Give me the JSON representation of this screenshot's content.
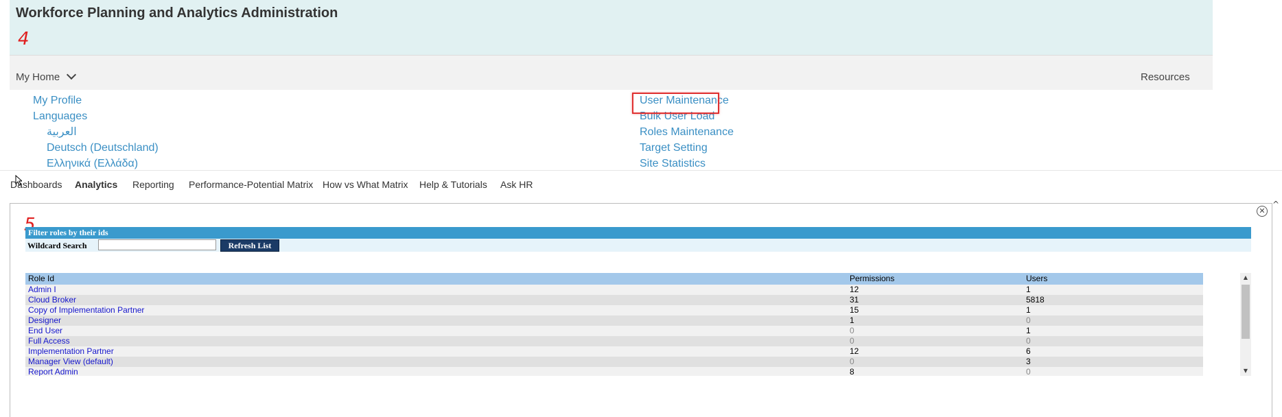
{
  "app": {
    "title": "Workforce Planning and Analytics Administration"
  },
  "annotations": {
    "step_4": "4",
    "step_5": "5"
  },
  "nav": {
    "my_home": "My Home",
    "resources": "Resources"
  },
  "menu": {
    "left": [
      {
        "label": "My Profile",
        "sub": false
      },
      {
        "label": "Languages",
        "sub": false
      },
      {
        "label": "العربية",
        "sub": true
      },
      {
        "label": "Deutsch (Deutschland)",
        "sub": true
      },
      {
        "label": "Ελληνικά (Ελλάδα)",
        "sub": true
      }
    ],
    "right": [
      {
        "label": "User Maintenance"
      },
      {
        "label": "Bulk User Load"
      },
      {
        "label": "Roles Maintenance",
        "highlighted": true
      },
      {
        "label": "Target Setting"
      },
      {
        "label": "Site Statistics"
      }
    ]
  },
  "tabs": [
    {
      "label": "Dashboards",
      "active": false
    },
    {
      "label": "Analytics",
      "active": true
    },
    {
      "label": "Reporting",
      "active": false
    },
    {
      "label": "Performance-Potential Matrix",
      "active": false
    },
    {
      "label": "How vs What Matrix",
      "active": false
    },
    {
      "label": "Help & Tutorials",
      "active": false
    },
    {
      "label": "Ask HR",
      "active": false
    }
  ],
  "filter": {
    "header": "Filter roles by their ids",
    "wildcard_label": "Wildcard Search",
    "wildcard_value": "",
    "refresh_label": "Refresh List"
  },
  "table": {
    "columns": [
      "Role Id",
      "Permissions",
      "Users"
    ],
    "rows": [
      {
        "role": "Admin I",
        "permissions": "12",
        "users": "1"
      },
      {
        "role": "Cloud Broker",
        "permissions": "31",
        "users": "5818"
      },
      {
        "role": "Copy of Implementation Partner",
        "permissions": "15",
        "users": "1"
      },
      {
        "role": "Designer",
        "permissions": "1",
        "users": "0"
      },
      {
        "role": "End User",
        "permissions": "0",
        "users": "1"
      },
      {
        "role": "Full Access",
        "permissions": "0",
        "users": "0"
      },
      {
        "role": "Implementation Partner",
        "permissions": "12",
        "users": "6"
      },
      {
        "role": "Manager View (default)",
        "permissions": "0",
        "users": "3"
      },
      {
        "role": "Report Admin",
        "permissions": "8",
        "users": "0"
      }
    ]
  },
  "colors": {
    "link": "#3a8fc4",
    "header_blue": "#3a9acd",
    "table_header": "#a3c8ea",
    "highlight": "#e03030",
    "annotation": "#e02020"
  },
  "icons": [
    "chevron-down-icon",
    "close-icon",
    "chevron-up-icon",
    "cursor-icon"
  ]
}
